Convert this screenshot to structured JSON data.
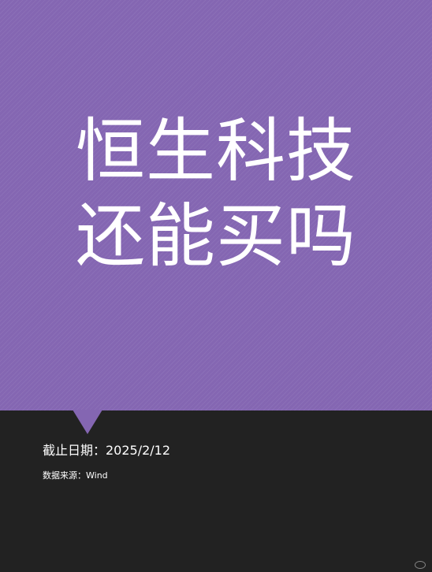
{
  "cover": {
    "title_line1": "恒生科技",
    "title_line2": "还能买吗",
    "cutoff_date": "截止日期：2025/2/12",
    "data_source": "数据来源：Wind"
  },
  "colors": {
    "accent_purple": "#8466b2",
    "dark_background": "#222222",
    "text": "#ffffff"
  }
}
